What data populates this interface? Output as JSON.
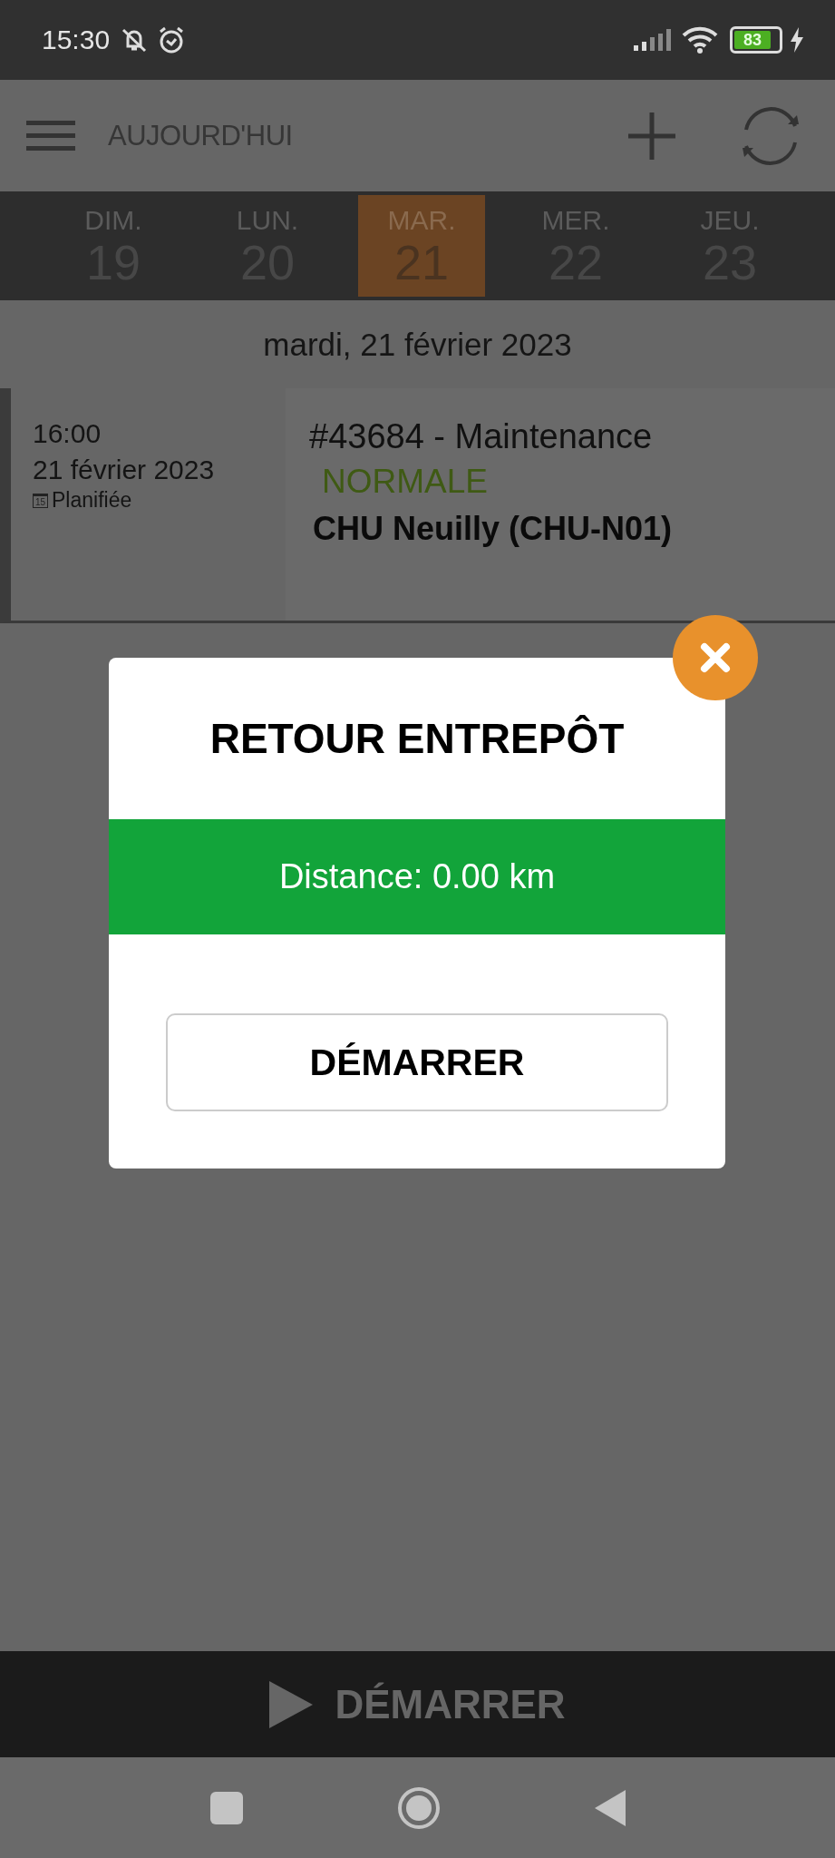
{
  "status_bar": {
    "time": "15:30",
    "battery": "83"
  },
  "header": {
    "title": "AUJOURD'HUI"
  },
  "days": [
    {
      "name": "DIM.",
      "number": "19",
      "selected": false
    },
    {
      "name": "LUN.",
      "number": "20",
      "selected": false
    },
    {
      "name": "MAR.",
      "number": "21",
      "selected": true
    },
    {
      "name": "MER.",
      "number": "22",
      "selected": false
    },
    {
      "name": "JEU.",
      "number": "23",
      "selected": false
    }
  ],
  "date_heading": "mardi, 21 février 2023",
  "event": {
    "time": "16:00",
    "date": "21 février 2023",
    "calendar_day": "15",
    "status": "Planifiée",
    "title": "#43684 - Maintenance",
    "priority": "NORMALE",
    "site": "CHU Neuilly (CHU-N01)"
  },
  "modal": {
    "title": "RETOUR ENTREPÔT",
    "distance": "Distance: 0.00 km",
    "button": "DÉMARRER"
  },
  "bottom_bar": {
    "button": "DÉMARRER"
  }
}
